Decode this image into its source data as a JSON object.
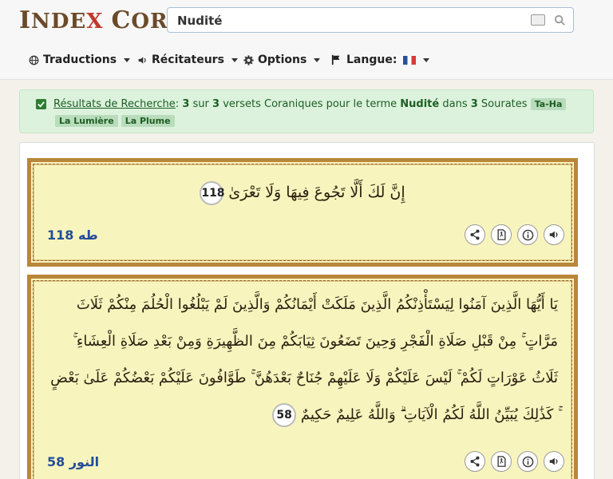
{
  "header": {
    "logo_part1": "I",
    "logo_part2": "NDE",
    "logo_x": "X",
    "logo_part3": "C",
    "logo_part4": "ORAN",
    "search_value": "Nudité"
  },
  "nav": {
    "translations": "Traductions",
    "reciters": "Récitateurs",
    "options": "Options",
    "language": "Langue:"
  },
  "results": {
    "link": "Résultats de Recherche",
    "colon": ":",
    "count": "3",
    "sur": "sur",
    "total": "3",
    "text1": "versets Coraniques pour le terme",
    "term": "Nudité",
    "dans": "dans",
    "surah_count": "3",
    "sourates": "Sourates",
    "tags": [
      "Ta-Ha",
      "La Lumière",
      "La Plume"
    ]
  },
  "verses": [
    {
      "arabic": "إِنَّ لَكَ أَلَّا تَجُوعَ فِيهَا وَلَا تَعْرَىٰ",
      "number": "118",
      "reference": "طه 118"
    },
    {
      "arabic": "يَا أَيُّهَا الَّذِينَ آمَنُوا لِيَسْتَأْذِنْكُمُ الَّذِينَ مَلَكَتْ أَيْمَانُكُمْ وَالَّذِينَ لَمْ يَبْلُغُوا الْحُلُمَ مِنْكُمْ ثَلَاثَ مَرَّاتٍ ۚ مِنْ قَبْلِ صَلَاةِ الْفَجْرِ وَحِينَ تَضَعُونَ ثِيَابَكُمْ مِنَ الظَّهِيرَةِ وَمِنْ بَعْدِ صَلَاةِ الْعِشَاءِ ۚ ثَلَاثُ عَوْرَاتٍ لَكُمْ ۚ لَيْسَ عَلَيْكُمْ وَلَا عَلَيْهِمْ جُنَاحٌ بَعْدَهُنَّ ۚ طَوَّافُونَ عَلَيْكُمْ بَعْضُكُمْ عَلَىٰ بَعْضٍ ۚ كَذَٰلِكَ يُبَيِّنُ اللَّهُ لَكُمُ الْآيَاتِ ۗ وَاللَّهُ عَلِيمٌ حَكِيمٌ",
      "number": "58",
      "reference": "النور 58"
    }
  ],
  "icons": [
    "globe-icon",
    "speaker-icon",
    "gear-icon",
    "flag-icon",
    "share-icon",
    "pdf-icon",
    "info-icon",
    "volume-icon",
    "keyboard-icon",
    "search-icon",
    "checkbox-icon"
  ],
  "colors": {
    "logo": "#6b4a2a",
    "alert_bg": "#dcf2dd",
    "verse_bg": "#f8f4bd",
    "reference": "#234d9a"
  }
}
